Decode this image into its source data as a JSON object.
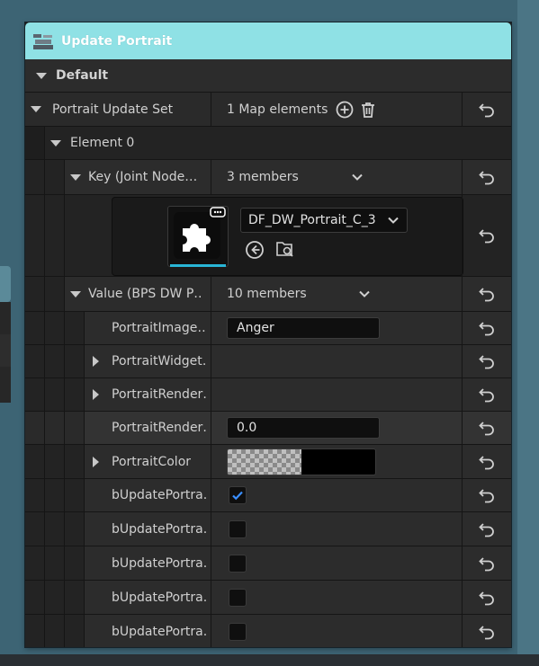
{
  "window": {
    "title": "Update Portrait"
  },
  "sections": {
    "default_label": "Default"
  },
  "portrait_update_set": {
    "label": "Portrait Update Set",
    "value": "1 Map elements"
  },
  "element": {
    "label": "Element 0"
  },
  "key": {
    "label": "Key (Joint Node…",
    "value": "3 members",
    "asset_name": "DF_DW_Portrait_C_3"
  },
  "value_struct": {
    "label": "Value (BPS DW P…",
    "value": "10 members"
  },
  "fields": [
    {
      "label": "PortraitImage…",
      "value": "Anger"
    },
    {
      "label": "PortraitWidget…"
    },
    {
      "label": "PortraitRender…"
    },
    {
      "label": "PortraitRender…",
      "value": "0.0"
    },
    {
      "label": "PortraitColor"
    },
    {
      "label": "bUpdatePortra…",
      "checked": true
    },
    {
      "label": "bUpdatePortra…",
      "checked": false
    },
    {
      "label": "bUpdatePortra…",
      "checked": false
    },
    {
      "label": "bUpdatePortra…",
      "checked": false
    },
    {
      "label": "bUpdatePortra…",
      "checked": false
    }
  ],
  "colors": {
    "title_bar": "#8fe1e5",
    "checkbox_check": "#3a8fff",
    "thumbnail_underline": "#29b6d6"
  }
}
